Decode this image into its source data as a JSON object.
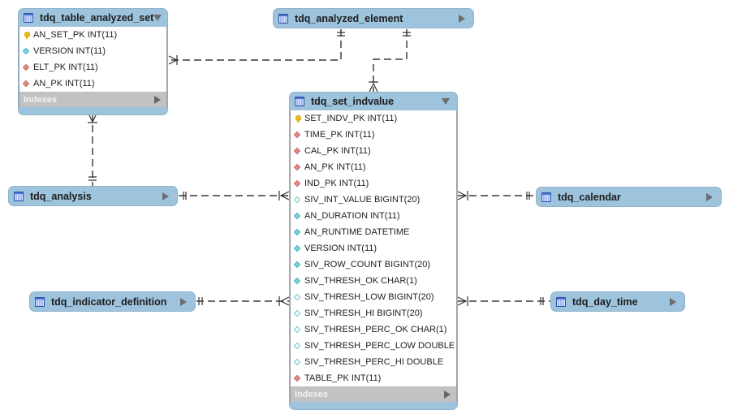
{
  "diagram": {
    "type": "er-diagram",
    "tables": {
      "table_analyzed_set": {
        "name": "tdq_table_analyzed_set",
        "expanded": true,
        "columns": [
          {
            "label": "AN_SET_PK INT(11)",
            "icon": "primary-key-icon"
          },
          {
            "label": "VERSION INT(11)",
            "icon": "not-null-column-icon"
          },
          {
            "label": "ELT_PK INT(11)",
            "icon": "foreign-key-icon"
          },
          {
            "label": "AN_PK INT(11)",
            "icon": "foreign-key-icon"
          }
        ],
        "indexes_label": "Indexes"
      },
      "analyzed_element": {
        "name": "tdq_analyzed_element",
        "expanded": false
      },
      "set_indvalue": {
        "name": "tdq_set_indvalue",
        "expanded": true,
        "columns": [
          {
            "label": "SET_INDV_PK INT(11)",
            "icon": "primary-key-icon"
          },
          {
            "label": "TIME_PK INT(11)",
            "icon": "foreign-key-icon"
          },
          {
            "label": "CAL_PK INT(11)",
            "icon": "foreign-key-icon"
          },
          {
            "label": "AN_PK INT(11)",
            "icon": "foreign-key-icon"
          },
          {
            "label": "IND_PK INT(11)",
            "icon": "foreign-key-icon"
          },
          {
            "label": "SIV_INT_VALUE BIGINT(20)",
            "icon": "nullable-column-icon"
          },
          {
            "label": "AN_DURATION INT(11)",
            "icon": "not-null-column-icon"
          },
          {
            "label": "AN_RUNTIME DATETIME",
            "icon": "not-null-column-icon"
          },
          {
            "label": "VERSION INT(11)",
            "icon": "not-null-column-icon"
          },
          {
            "label": "SIV_ROW_COUNT BIGINT(20)",
            "icon": "not-null-column-icon"
          },
          {
            "label": "SIV_THRESH_OK CHAR(1)",
            "icon": "not-null-column-icon"
          },
          {
            "label": "SIV_THRESH_LOW BIGINT(20)",
            "icon": "nullable-column-icon"
          },
          {
            "label": "SIV_THRESH_HI BIGINT(20)",
            "icon": "nullable-column-icon"
          },
          {
            "label": "SIV_THRESH_PERC_OK CHAR(1)",
            "icon": "nullable-column-icon"
          },
          {
            "label": "SIV_THRESH_PERC_LOW DOUBLE",
            "icon": "nullable-column-icon"
          },
          {
            "label": "SIV_THRESH_PERC_HI DOUBLE",
            "icon": "nullable-column-icon"
          },
          {
            "label": "TABLE_PK INT(11)",
            "icon": "foreign-key-icon"
          }
        ],
        "indexes_label": "Indexes"
      },
      "analysis": {
        "name": "tdq_analysis",
        "expanded": false
      },
      "calendar": {
        "name": "tdq_calendar",
        "expanded": false
      },
      "indicator_definition": {
        "name": "tdq_indicator_definition",
        "expanded": false
      },
      "day_time": {
        "name": "tdq_day_time",
        "expanded": false
      }
    },
    "relationships": [
      {
        "from": "tdq_analyzed_element",
        "to": "tdq_table_analyzed_set",
        "cardinality": "one-to-many"
      },
      {
        "from": "tdq_analyzed_element",
        "to": "tdq_set_indvalue",
        "cardinality": "one-to-many"
      },
      {
        "from": "tdq_analysis",
        "to": "tdq_table_analyzed_set",
        "cardinality": "one-to-many"
      },
      {
        "from": "tdq_analysis",
        "to": "tdq_set_indvalue",
        "cardinality": "one-to-many"
      },
      {
        "from": "tdq_calendar",
        "to": "tdq_set_indvalue",
        "cardinality": "one-to-many"
      },
      {
        "from": "tdq_indicator_definition",
        "to": "tdq_set_indvalue",
        "cardinality": "one-to-many"
      },
      {
        "from": "tdq_day_time",
        "to": "tdq_set_indvalue",
        "cardinality": "one-to-many"
      }
    ],
    "colors": {
      "table_header": "#9dc3dd",
      "indexes_bar": "#c2c2c2",
      "primary_key": "#f5c51a",
      "foreign_key": "#e58a8a",
      "not_null_column": "#79d2dc",
      "relationship_line": "#000000"
    }
  }
}
